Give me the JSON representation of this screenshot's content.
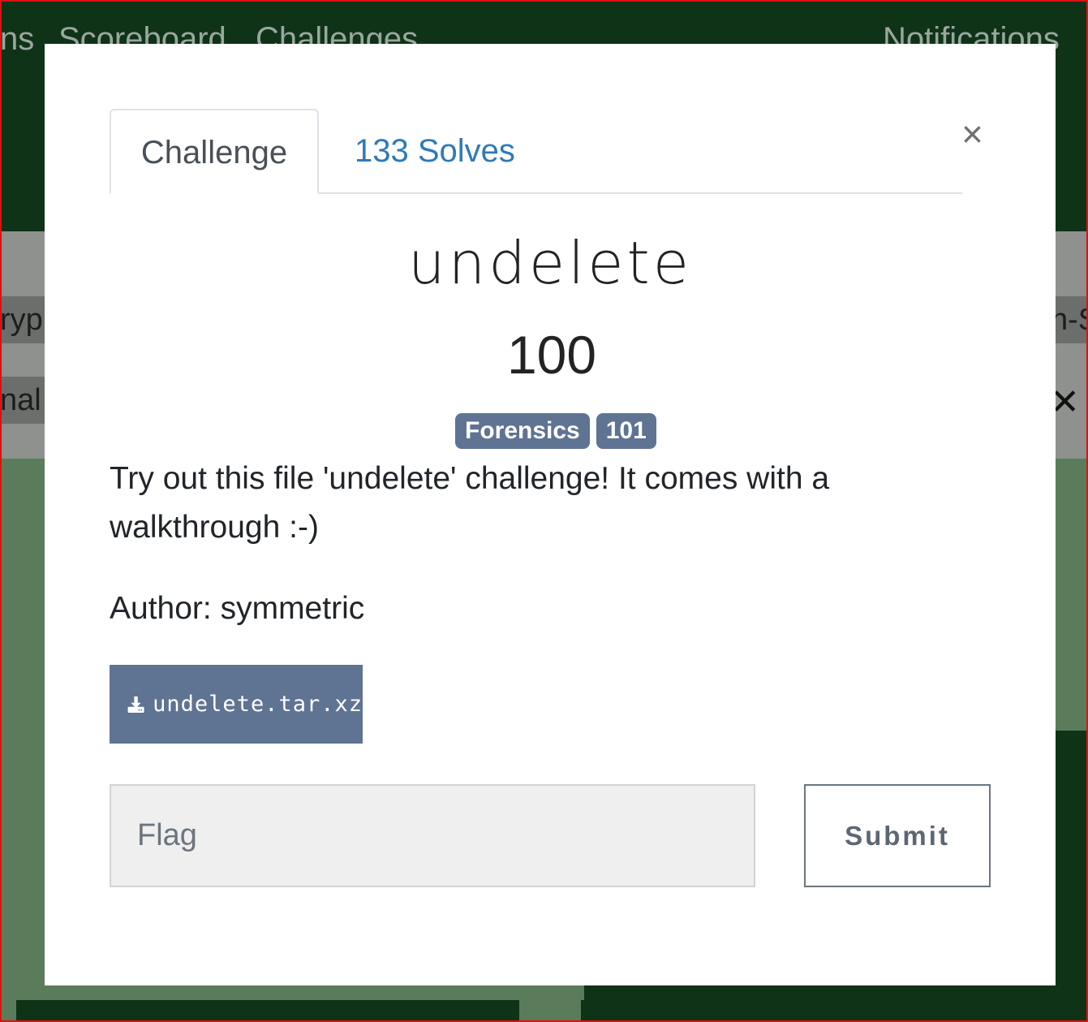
{
  "background": {
    "nav": {
      "item_partial_left": "ns",
      "scoreboard": "Scoreboard",
      "challenges": "Challenges",
      "notifications": "Notifications"
    },
    "row1_left": "ryp",
    "row1_right": "n-S",
    "row2_left": "nal",
    "close_glyph": "✕"
  },
  "modal": {
    "close_label": "×",
    "tabs": [
      {
        "label": "Challenge"
      },
      {
        "label": "133 Solves"
      }
    ],
    "challenge": {
      "name": "undelete",
      "value": "100",
      "tags": [
        "Forensics",
        "101"
      ],
      "description": "Try out this file 'undelete' challenge! It comes with a walkthrough :-)",
      "author": "Author: symmetric",
      "file": {
        "label": "undelete.tar.xz",
        "icon": "download-icon"
      }
    },
    "flag": {
      "placeholder": "Flag",
      "value": ""
    },
    "submit_label": "Submit"
  },
  "colors": {
    "badge": "#5f7393",
    "tab_link": "#2f7ab8",
    "nav_bg": "#0f3317"
  }
}
